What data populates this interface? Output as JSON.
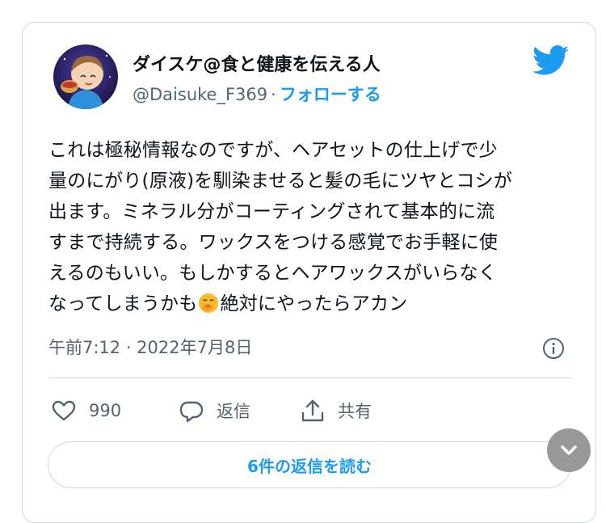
{
  "author": {
    "display_name": "ダイスケ@食と健康を伝える人",
    "handle": "@Daisuke_F369",
    "separator": "·",
    "follow_label": "フォローする"
  },
  "tweet": {
    "lines": [
      "これは極秘情報なのですが、ヘアセットの仕上げで少",
      "量のにがり(原液)を馴染ませると髪の毛にツヤとコシが",
      "出ます。ミネラル分がコーティングされて基本的に流",
      "すまで持続する。ワックスをつける感覚でお手軽に使",
      "えるのもいい。もしかするとヘアワックスがいらなく"
    ],
    "last_line_before_emoji": "なってしまうかも",
    "emoji": "hand-over-mouth-emoji",
    "last_line_after_emoji": "絶対にやったらアカン"
  },
  "meta": {
    "timestamp": "午前7:12 · 2022年7月8日"
  },
  "actions": {
    "like_count": "990",
    "reply_label": "返信",
    "share_label": "共有"
  },
  "read_replies_label": "6件の返信を読む",
  "colors": {
    "accent": "#1d9bf0",
    "text": "#0f1419",
    "muted": "#536471",
    "border": "#cfd9de"
  }
}
